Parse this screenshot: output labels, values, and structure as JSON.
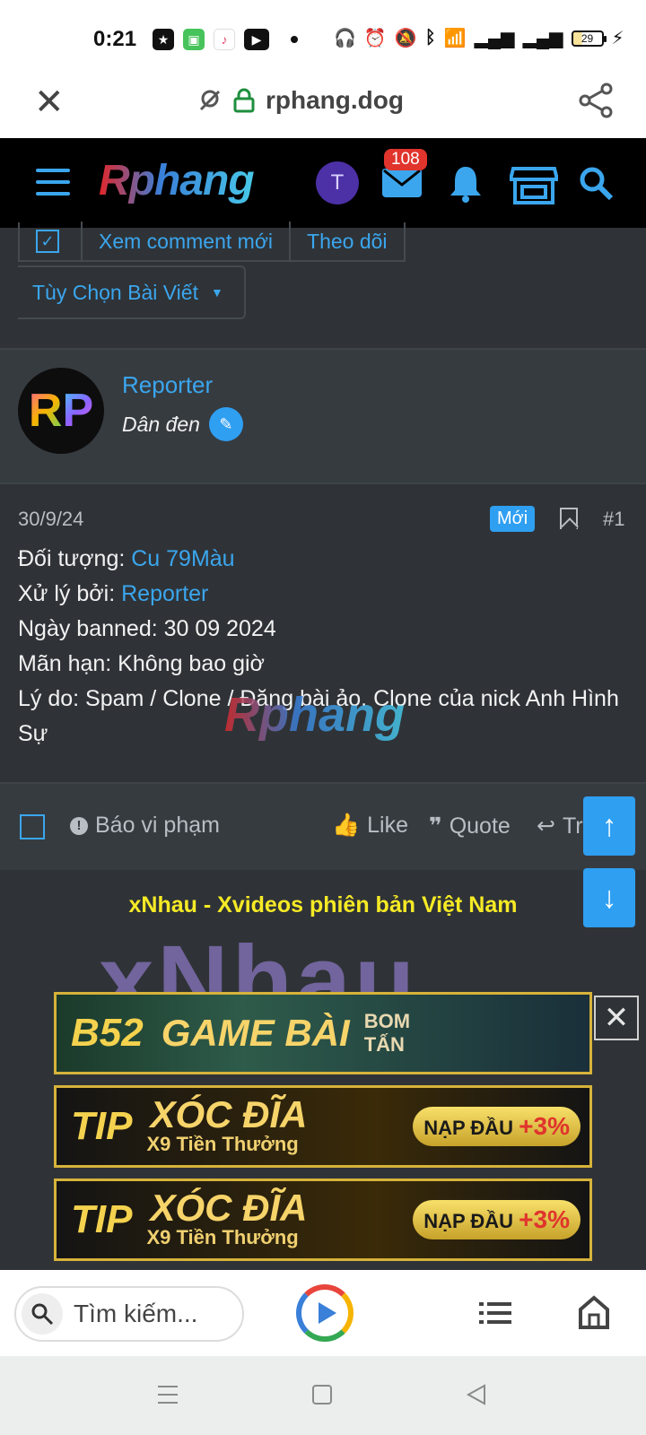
{
  "status_bar": {
    "time": "0:21",
    "battery": "29"
  },
  "browser": {
    "url": "rphang.dog"
  },
  "site": {
    "logo": "Rphang",
    "avatar_initial": "T",
    "messages_badge": "108"
  },
  "thread_actions": {
    "new_comments": "Xem comment mới",
    "follow": "Theo dõi",
    "post_options": "Tùy Chọn Bài Viết"
  },
  "post": {
    "avatar_text_1": "R",
    "avatar_text_2": "P",
    "username": "Reporter",
    "user_title": "Dân đen",
    "date": "30/9/24",
    "new_badge": "Mới",
    "post_number": "#1",
    "line1_label": "Đối tượng: ",
    "line1_value": "Cu 79Màu",
    "line2_label": "Xử lý bởi: ",
    "line2_value": "Reporter",
    "line3": "Ngày banned: 30 09 2024",
    "line4": "Mãn hạn: Không bao giờ",
    "line5": "Lý do: Spam / Clone / Đăng bài ảo. Clone của nick Anh Hình Sự",
    "watermark": "Rphang"
  },
  "post_footer": {
    "report": "Báo vi phạm",
    "like": "Like",
    "quote": "Quote",
    "reply": "Tr"
  },
  "promo": {
    "title": "xNhau - Xvideos phiên bản Việt Nam",
    "logo_text": "xNhau"
  },
  "ads": [
    {
      "brand": "B52",
      "main": "GAME BÀI",
      "side": "BOM TẤN"
    },
    {
      "brand": "TIP",
      "main": "XÓC ĐĨA",
      "sub": "X9 Tiền Thưởng",
      "pill": "NẠP ĐẦU",
      "bonus": "+3%"
    },
    {
      "brand": "TIP",
      "main": "XÓC ĐĨA",
      "sub": "X9 Tiền Thưởng",
      "pill": "NẠP ĐẦU",
      "bonus": "+3%"
    }
  ],
  "bottom_bar": {
    "search_placeholder": "Tìm kiếm..."
  },
  "colors": {
    "accent": "#3ba6ee",
    "header_bg": "#000000",
    "page_bg": "#2f3337",
    "badge": "#e0342c",
    "promo_title": "#f6ea25"
  }
}
